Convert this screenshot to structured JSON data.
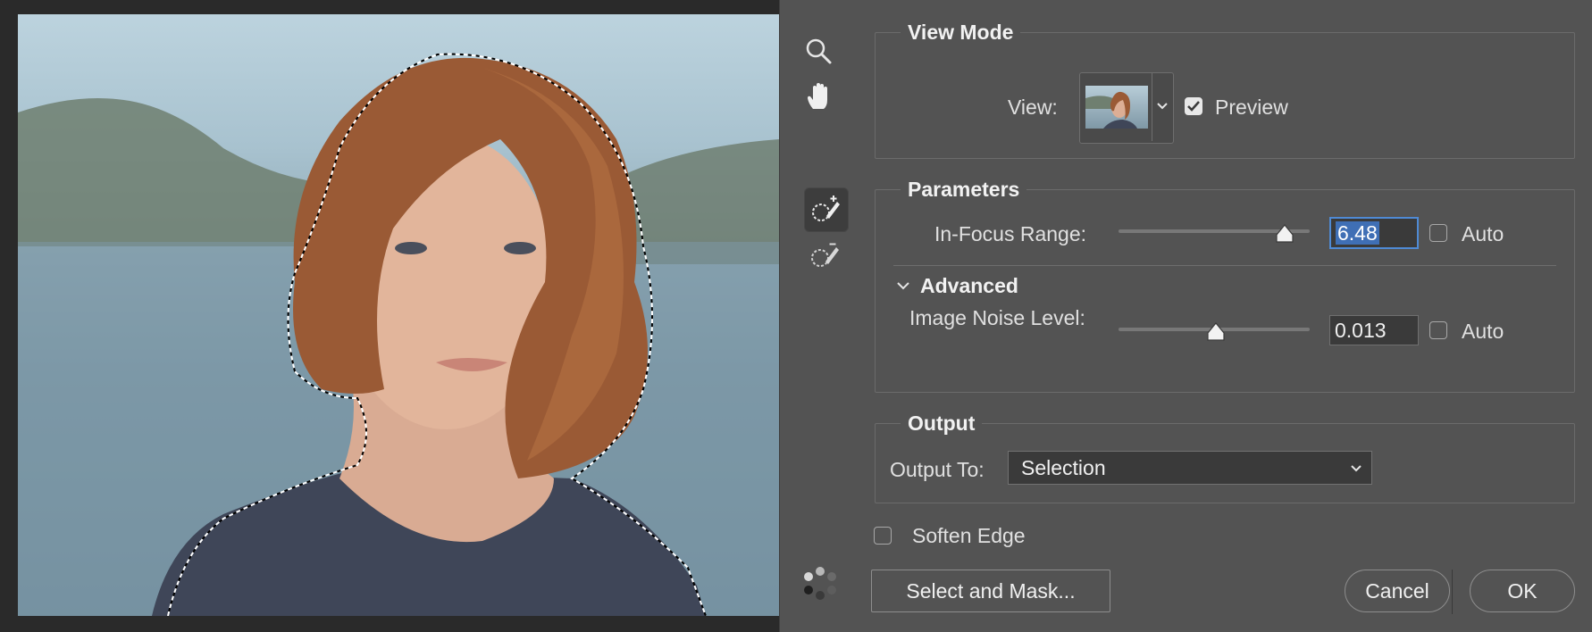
{
  "icons": {
    "zoom": "zoom-icon",
    "hand": "hand-icon",
    "add_selection": "focus-area-add-brush-icon",
    "subtract_selection": "focus-area-subtract-brush-icon",
    "spinner": "progress-spinner-icon"
  },
  "view_mode": {
    "legend": "View Mode",
    "view_label": "View:",
    "preview_label": "Preview",
    "preview_checked": true
  },
  "parameters": {
    "legend": "Parameters",
    "in_focus_range_label": "In-Focus Range:",
    "in_focus_range_value": "6.48",
    "in_focus_range_slider": 0.87,
    "in_focus_auto_label": "Auto",
    "in_focus_auto_checked": false,
    "advanced_label": "Advanced",
    "noise_label": "Image Noise Level:",
    "noise_value": "0.013",
    "noise_slider": 0.51,
    "noise_auto_label": "Auto",
    "noise_auto_checked": false
  },
  "output": {
    "legend": "Output",
    "output_to_label": "Output To:",
    "output_to_value": "Selection",
    "soften_edge_label": "Soften Edge",
    "soften_edge_checked": false
  },
  "buttons": {
    "select_and_mask": "Select and Mask...",
    "cancel": "Cancel",
    "ok": "OK"
  },
  "colors": {
    "dialog_bg": "#535353",
    "accent": "#4f8ad4",
    "selection_highlight": "#3f6fb5"
  }
}
